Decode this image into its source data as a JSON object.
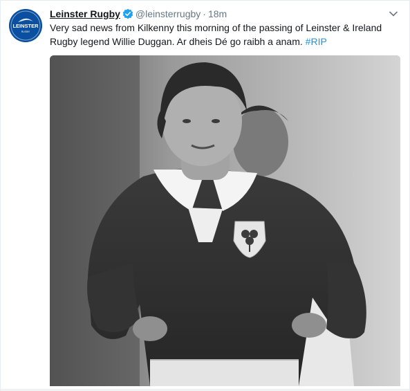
{
  "tweet": {
    "avatar_icon": "leinster-rugby-logo-icon",
    "avatar_logo_text": "LEINSTER",
    "avatar_logo_subtext": "RUGBY",
    "display_name": "Leinster Rugby",
    "verified_icon": "verified-badge-icon",
    "handle": "@leinsterrugby",
    "separator": "·",
    "timestamp": "18m",
    "more_icon": "chevron-down-icon",
    "text": "Very sad news from Kilkenny this morning of the passing of Leinster & Ireland Rugby legend Willie Duggan. Ar dheis Dé go raibh a anam. ",
    "hashtag": "#RIP",
    "photo_icon": "tweet-photo",
    "colors": {
      "brand_blue": "#0b4fa0",
      "link_blue": "#1b95e0",
      "verified_blue": "#1da1f2",
      "muted_gray": "#657786"
    }
  }
}
